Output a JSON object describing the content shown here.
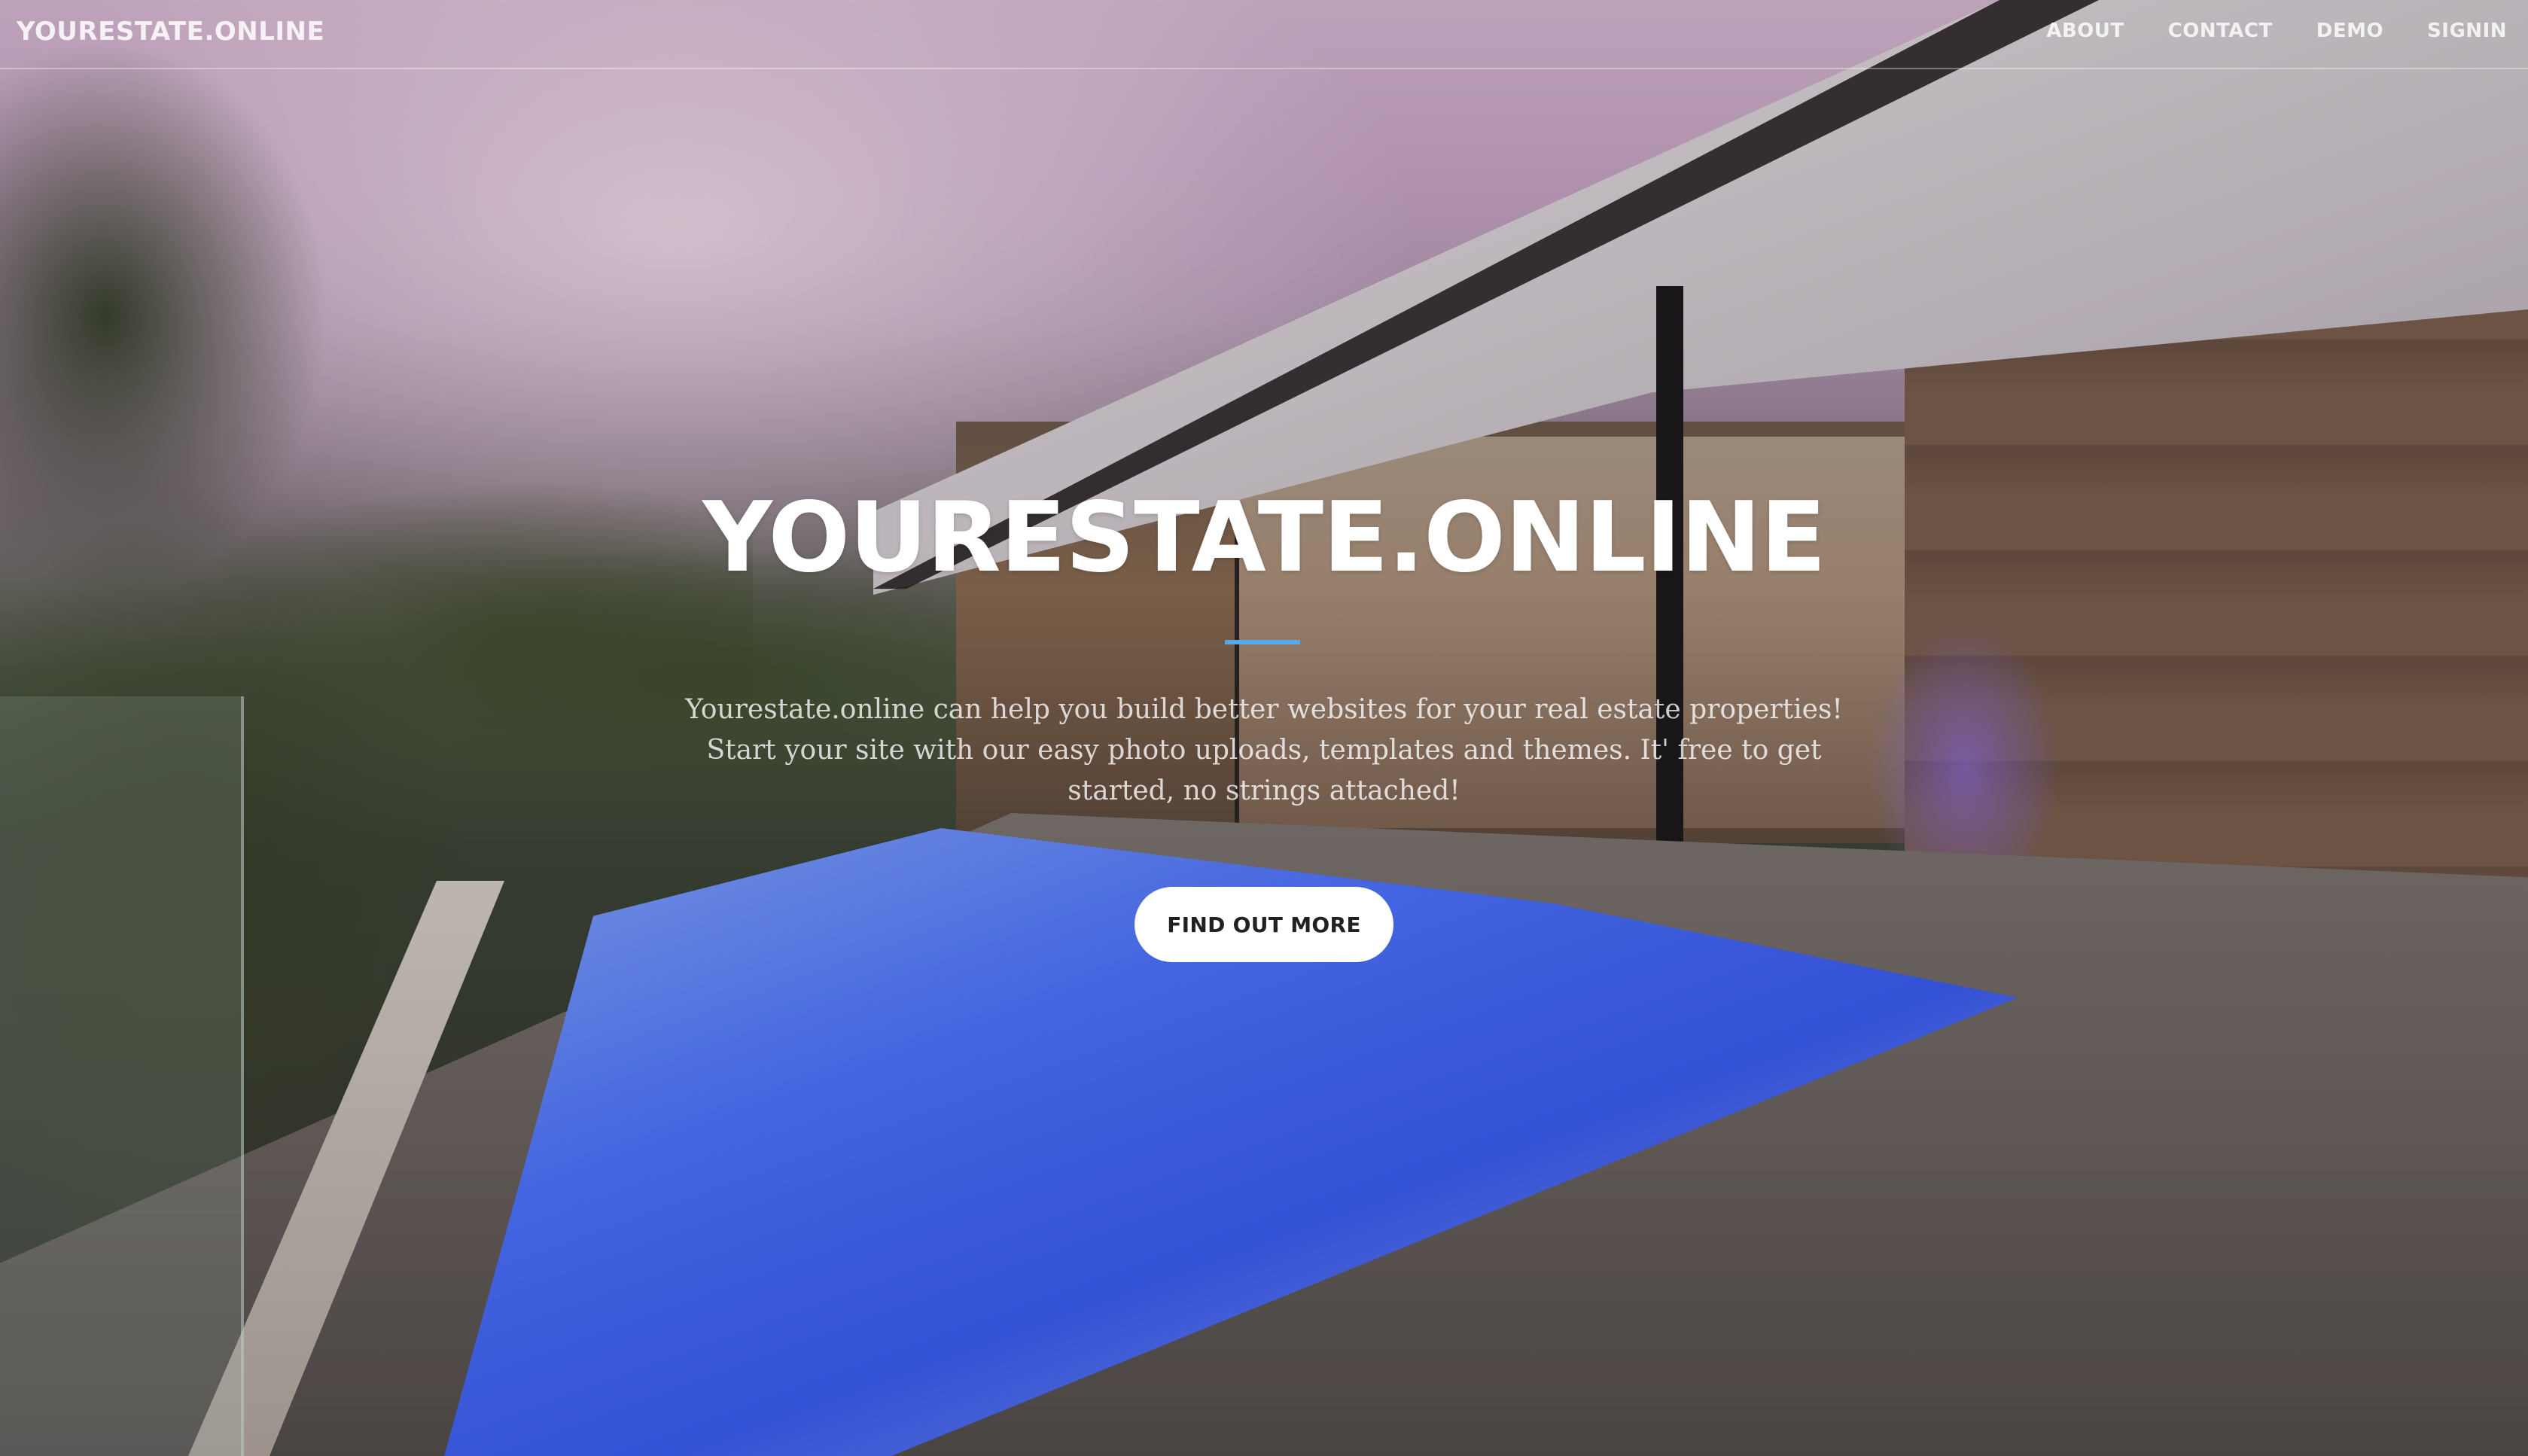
{
  "nav": {
    "brand": "YOURESTATE.ONLINE",
    "links": [
      {
        "label": "ABOUT"
      },
      {
        "label": "CONTACT"
      },
      {
        "label": "DEMO"
      },
      {
        "label": "SIGNIN"
      }
    ]
  },
  "hero": {
    "title": "YOURESTATE.ONLINE",
    "description": "Yourestate.online can help you build better websites for your real estate properties! Start your site with our easy photo uploads, templates and themes. It' free to get started, no strings attached!",
    "button_label": "FIND OUT MORE"
  },
  "colors": {
    "divider_accent": "#5aa7e6",
    "button_bg": "#ffffff",
    "button_text": "#212121"
  }
}
